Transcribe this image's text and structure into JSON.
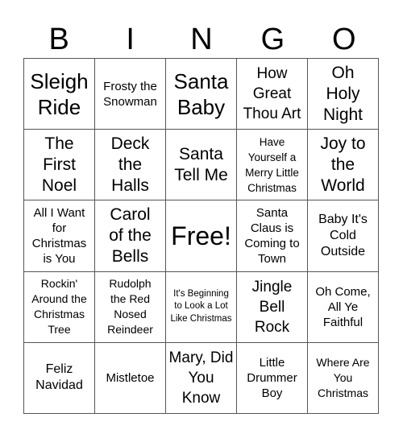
{
  "header": {
    "letters": [
      "B",
      "I",
      "N",
      "G",
      "O"
    ]
  },
  "cells": [
    "Sleigh Ride",
    "Frosty the Snowman",
    "Santa Baby",
    "How Great Thou Art",
    "Oh Holy Night",
    "The First Noel",
    "Deck the Halls",
    "Santa Tell Me",
    "Have Yourself a Merry Little Christmas",
    "Joy to the World",
    "All I Want for Christmas is You",
    "Carol of the Bells",
    "Free!",
    "Santa Claus is Coming to Town",
    "Baby It's Cold Outside",
    "Rockin' Around the Christmas Tree",
    "Rudolph the Red Nosed Reindeer",
    "It's Beginning to Look a Lot Like Christmas",
    "Jingle Bell Rock",
    "Oh Come, All Ye Faithful",
    "Feliz Navidad",
    "Mistletoe",
    "Mary, Did You Know",
    "Little Drummer Boy",
    "Where Are You Christmas"
  ]
}
